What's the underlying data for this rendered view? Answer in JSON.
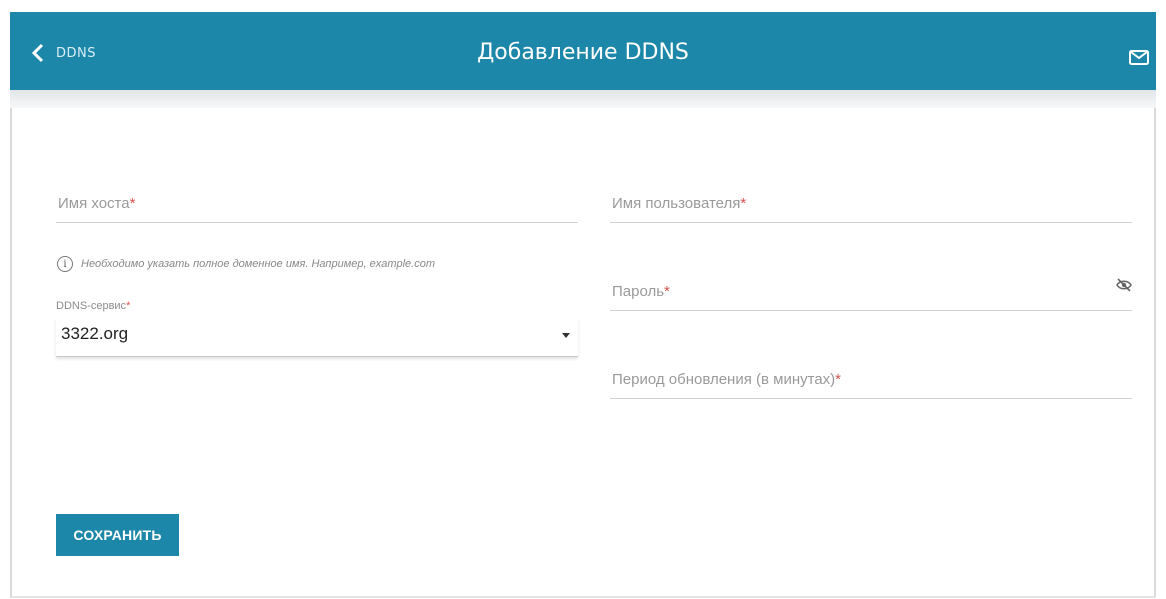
{
  "header": {
    "back_label": "DDNS",
    "title": "Добавление DDNS",
    "back_icon": "chevron-left-icon",
    "mail_icon": "envelope-icon",
    "color": "#1c87a8"
  },
  "form": {
    "hostname": {
      "label": "Имя хоста",
      "required_mark": "*",
      "value": ""
    },
    "hint": {
      "icon": "info-icon",
      "glyph": "i",
      "text": "Необходимо указать полное доменное имя. Например, example.com"
    },
    "ddns_service": {
      "label": "DDNS-сервис",
      "required_mark": "*",
      "selected": "3322.org"
    },
    "username": {
      "label": "Имя пользователя",
      "required_mark": "*",
      "value": ""
    },
    "password": {
      "label": "Пароль",
      "required_mark": "*",
      "value": "",
      "toggle_icon": "eye-off-icon"
    },
    "period": {
      "label": "Период обновления (в минутах)",
      "required_mark": "*",
      "value": ""
    }
  },
  "actions": {
    "save_label": "СОХРАНИТЬ"
  }
}
